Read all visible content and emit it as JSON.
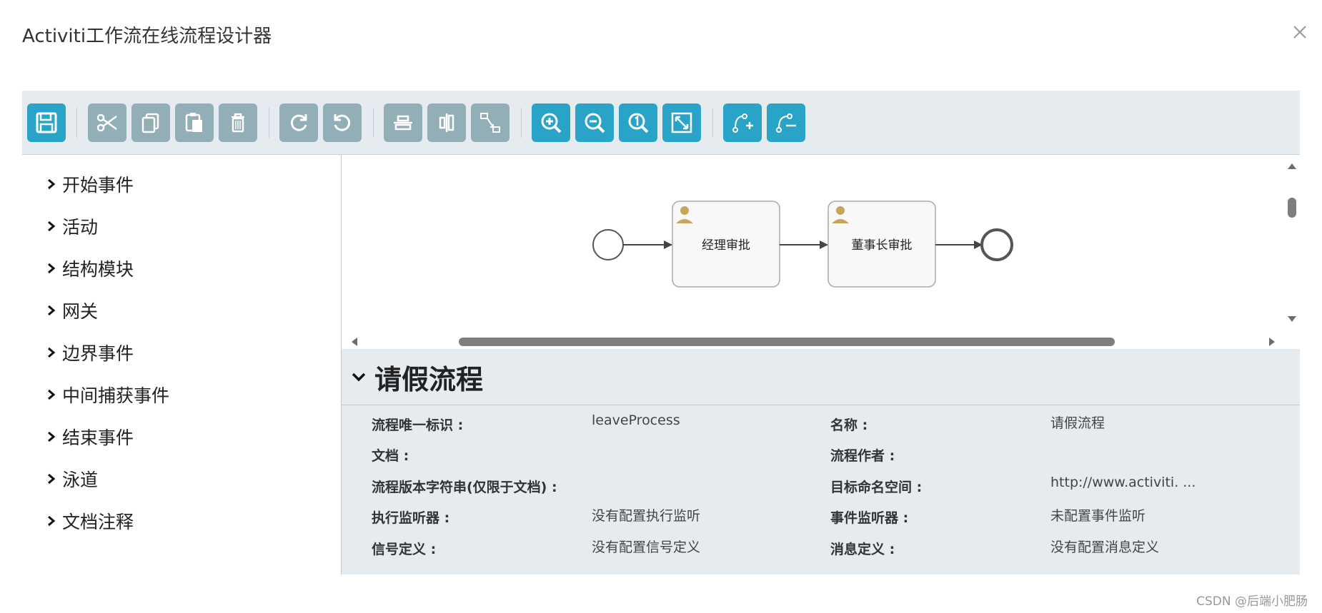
{
  "window": {
    "title": "Activiti工作流在线流程设计器",
    "close_icon": "close-icon"
  },
  "toolbar": {
    "buttons": [
      {
        "name": "save",
        "icon": "save-icon",
        "color": "#2aa3c8"
      },
      {
        "name": "cut",
        "icon": "cut-icon",
        "color": "#92aeb6"
      },
      {
        "name": "copy",
        "icon": "copy-icon",
        "color": "#92aeb6"
      },
      {
        "name": "paste",
        "icon": "paste-icon",
        "color": "#92aeb6"
      },
      {
        "name": "delete",
        "icon": "trash-icon",
        "color": "#92aeb6"
      },
      {
        "name": "redo",
        "icon": "redo-icon",
        "color": "#92aeb6"
      },
      {
        "name": "undo",
        "icon": "undo-icon",
        "color": "#92aeb6"
      },
      {
        "name": "align-horizontal",
        "icon": "align-horizontal-icon",
        "color": "#92aeb6"
      },
      {
        "name": "align-vertical",
        "icon": "align-vertical-icon",
        "color": "#92aeb6"
      },
      {
        "name": "same-size",
        "icon": "same-size-icon",
        "color": "#92aeb6"
      },
      {
        "name": "zoom-in",
        "icon": "zoom-in-icon",
        "color": "#2aa3c8"
      },
      {
        "name": "zoom-out",
        "icon": "zoom-out-icon",
        "color": "#2aa3c8"
      },
      {
        "name": "zoom-actual",
        "icon": "zoom-actual-icon",
        "color": "#2aa3c8"
      },
      {
        "name": "zoom-fit",
        "icon": "zoom-fit-icon",
        "color": "#2aa3c8"
      },
      {
        "name": "add-bendpoint",
        "icon": "add-bendpoint-icon",
        "color": "#2aa3c8"
      },
      {
        "name": "remove-bendpoint",
        "icon": "remove-bendpoint-icon",
        "color": "#2aa3c8"
      }
    ]
  },
  "palette": {
    "items": [
      {
        "label": "开始事件"
      },
      {
        "label": "活动"
      },
      {
        "label": "结构模块"
      },
      {
        "label": "网关"
      },
      {
        "label": "边界事件"
      },
      {
        "label": "中间捕获事件"
      },
      {
        "label": "结束事件"
      },
      {
        "label": "泳道"
      },
      {
        "label": "文档注释"
      }
    ]
  },
  "canvas": {
    "tasks": [
      {
        "label": "经理审批",
        "icon": "user-icon"
      },
      {
        "label": "董事长审批",
        "icon": "user-icon"
      }
    ]
  },
  "properties": {
    "title": "请假流程",
    "rows": [
      {
        "label": "流程唯一标识 :",
        "value": "leaveProcess"
      },
      {
        "label": "名称 :",
        "value": "请假流程"
      },
      {
        "label": "文档 :",
        "value": ""
      },
      {
        "label": "流程作者 :",
        "value": ""
      },
      {
        "label": "流程版本字符串(仅限于文档) :",
        "value": ""
      },
      {
        "label": "目标命名空间 :",
        "value": "http://www.activiti. ..."
      },
      {
        "label": "执行监听器 :",
        "value": "没有配置执行监听"
      },
      {
        "label": "事件监听器 :",
        "value": "未配置事件监听"
      },
      {
        "label": "信号定义 :",
        "value": "没有配置信号定义"
      },
      {
        "label": "消息定义 :",
        "value": "没有配置消息定义"
      }
    ]
  },
  "watermark": "CSDN @后端小肥肠"
}
